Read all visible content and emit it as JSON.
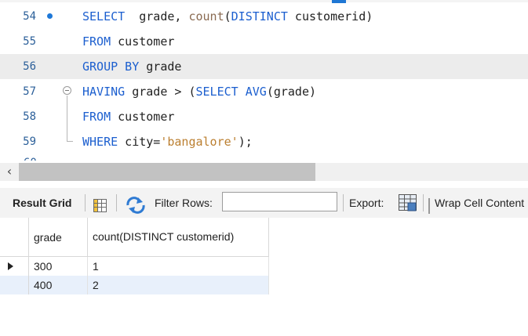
{
  "editor": {
    "lines": [
      {
        "num": "54",
        "tokens": [
          [
            "kw",
            "SELECT"
          ],
          [
            "",
            "  grade, "
          ],
          [
            "fn",
            "count"
          ],
          [
            "",
            "("
          ],
          [
            "kw",
            "DISTINCT"
          ],
          [
            "",
            " customerid)"
          ]
        ]
      },
      {
        "num": "55",
        "tokens": [
          [
            "kw",
            "FROM"
          ],
          [
            "",
            " customer"
          ]
        ]
      },
      {
        "num": "56",
        "tokens": [
          [
            "kw",
            "GROUP BY"
          ],
          [
            "",
            " grade"
          ]
        ]
      },
      {
        "num": "57",
        "tokens": [
          [
            "kw",
            "HAVING"
          ],
          [
            "",
            " grade > ("
          ],
          [
            "kw",
            "SELECT"
          ],
          [
            "",
            " "
          ],
          [
            "kw",
            "AVG"
          ],
          [
            "",
            "(grade)"
          ]
        ]
      },
      {
        "num": "58",
        "tokens": [
          [
            "kw",
            "FROM"
          ],
          [
            "",
            " customer"
          ]
        ]
      },
      {
        "num": "59",
        "tokens": [
          [
            "kw",
            "WHERE"
          ],
          [
            "",
            " city="
          ],
          [
            "str",
            "'bangalore'"
          ],
          [
            "",
            ");"
          ]
        ]
      }
    ],
    "partial_line_num": "60"
  },
  "toolbar": {
    "result_grid_label": "Result Grid",
    "filter_rows_label": "Filter Rows:",
    "filter_rows_value": "",
    "export_label": "Export:",
    "wrap_cell_label": "Wrap Cell Content"
  },
  "grid": {
    "columns": [
      "grade",
      "count(DISTINCT customerid)"
    ],
    "rows": [
      [
        "300",
        "1"
      ],
      [
        "400",
        "2"
      ]
    ]
  },
  "colors": {
    "keyword": "#1c5fcf",
    "function": "#8a6b52",
    "string": "#bb7f30",
    "line_number": "#2b5f99",
    "highlight_line": "#ececec",
    "selected_row": "#e8f0fb"
  },
  "icons": [
    "scroll-left-arrow-icon",
    "grid-layout-icon",
    "refresh-icon",
    "export-icon",
    "wrap-icon",
    "row-pointer-icon"
  ]
}
